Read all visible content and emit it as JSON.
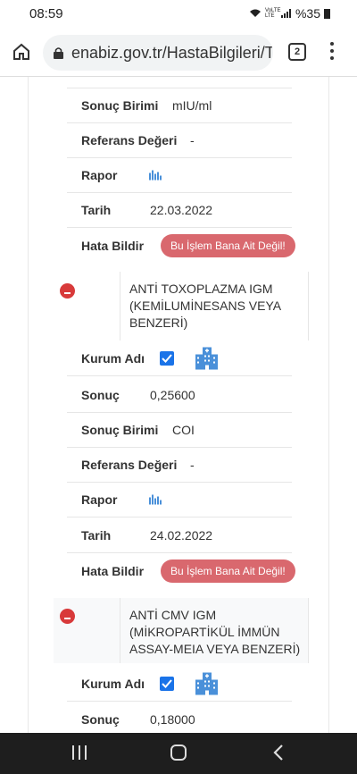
{
  "status_bar": {
    "time": "08:59",
    "network": "VoLTE LTE",
    "battery": "%35"
  },
  "browser": {
    "url": "enabiz.gov.tr/HastaBilgileri/T",
    "tab_count": "2"
  },
  "labels": {
    "unit": "Sonuç Birimi",
    "reference": "Referans Değeri",
    "report": "Rapor",
    "date": "Tarih",
    "report_error": "Hata Bildir",
    "institution": "Kurum Adı",
    "result": "Sonuç"
  },
  "error_button_label": "Bu İşlem Bana Ait Değil!",
  "top_partial": {
    "unit": "mIU/ml",
    "reference": "-",
    "date": "22.03.2022"
  },
  "tests": [
    {
      "name": "ANTİ TOXOPLAZMA IGM (KEMİLUMİNESANS VEYA BENZERİ)",
      "result": "0,25600",
      "unit": "COI",
      "reference": "-",
      "date": "24.02.2022"
    },
    {
      "name": "ANTİ CMV IGM (MİKROPARTİKÜL İMMÜN ASSAY-MEIA VEYA BENZERİ)",
      "result": "0,18000"
    }
  ],
  "colors": {
    "error_button": "#d9686e",
    "minus_badge": "#d83a3a",
    "checkbox": "#1a73e8",
    "icon_blue": "#4a90d9"
  }
}
